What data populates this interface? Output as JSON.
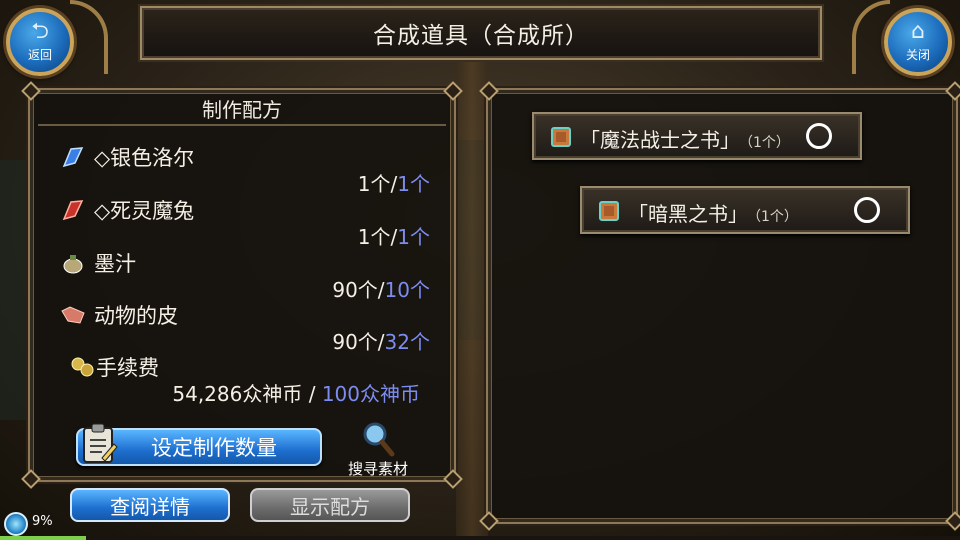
{
  "window": {
    "title": "合成道具（合成所）"
  },
  "nav": {
    "back_label": "返回",
    "close_label": "关闭"
  },
  "recipe": {
    "header": "制作配方",
    "materials": [
      {
        "name": "◇银色洛尔",
        "have": "1个/",
        "need": "1个",
        "icon": "blue-crystal-icon"
      },
      {
        "name": "◇死灵魔兔",
        "have": "1个/",
        "need": "1个",
        "icon": "red-crystal-icon"
      },
      {
        "name": "墨汁",
        "have": "90个/",
        "need": "10个",
        "icon": "ink-pouch-icon"
      },
      {
        "name": "动物的皮",
        "have": "90个/",
        "need": "32个",
        "icon": "animal-hide-icon"
      }
    ],
    "fee": {
      "label": "手续费",
      "have": "54,286众神币 / ",
      "need": "100众神币",
      "icon": "coins-icon"
    },
    "set_quantity_label": "设定制作数量",
    "search_materials_label": "搜寻素材"
  },
  "actions": {
    "view_details": "查阅详情",
    "show_recipe": "显示配方"
  },
  "results": [
    {
      "name": "「魔法战士之书」",
      "count": "（1个）",
      "icon": "book-icon"
    },
    {
      "name": "「暗黑之书」",
      "count": "（1个）",
      "icon": "book-icon"
    }
  ],
  "status": {
    "percent": "9%",
    "xp_fraction": 0.09
  },
  "colors": {
    "need_text": "#7c8cf0",
    "button_blue": "#1e6fd0",
    "frame_gold": "#8e7858"
  }
}
